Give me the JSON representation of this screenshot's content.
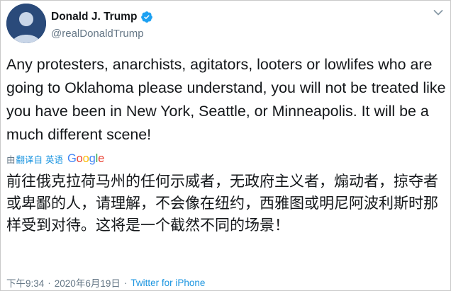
{
  "user": {
    "name": "Donald J. Trump",
    "handle": "@realDonaldTrump"
  },
  "tweet": {
    "text_en": "Any protesters, anarchists, agitators, looters or lowlifes who are going to Oklahoma please understand, you will not be treated like you have been in New York, Seattle, or Minneapolis. It will be a much different scene!",
    "translation_prefix": "由",
    "translation_link": "翻译自 英语",
    "translation_provider": "Google",
    "text_zh": "前往俄克拉荷马州的任何示威者，无政府主义者，煽动者，掠夺者或卑鄙的人，请理解，不会像在纽约，西雅图或明尼阿波利斯时那样受到对待。这将是一个截然不同的场景！"
  },
  "meta": {
    "time": "下午9:34",
    "separator1": "·",
    "date": "2020年6月19日",
    "separator2": "·",
    "source": "Twitter for iPhone"
  },
  "colors": {
    "link": "#1b95e0",
    "muted": "#657786",
    "verified": "#1da1f2",
    "text": "#14171a"
  },
  "icons": [
    "avatar",
    "verified-badge-icon",
    "chevron-down-icon"
  ]
}
